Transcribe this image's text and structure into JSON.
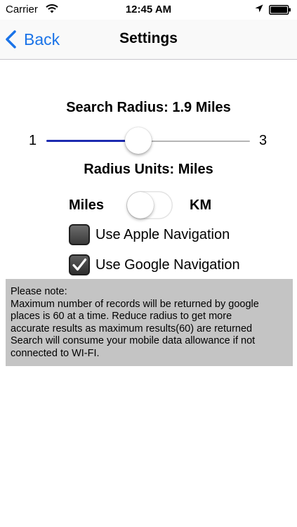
{
  "status_bar": {
    "carrier": "Carrier",
    "time": "12:45 AM",
    "icons": [
      "wifi-icon",
      "location-icon",
      "battery-icon"
    ]
  },
  "nav_bar": {
    "back_label": "Back",
    "title": "Settings",
    "accent_color": "#1a73e8"
  },
  "search_radius": {
    "label": "Search Radius: 1.9 Miles",
    "min_label": "1",
    "max_label": "3",
    "min": 1,
    "max": 3,
    "value": 1.9,
    "fill_color": "#1d2bb0"
  },
  "radius_units": {
    "label": "Radius Units: Miles",
    "left_label": "Miles",
    "right_label": "KM",
    "toggle_on": false
  },
  "navigation_options": {
    "apple_label": "Use Apple Navigation",
    "apple_checked": false,
    "google_label": "Use Google Navigation",
    "google_checked": true
  },
  "note": {
    "lines": [
      "Please note:",
      "Maximum number of records will be returned by google",
      "places is 60 at a time. Reduce radius to get more",
      "accurate results as maximum results(60) are returned",
      "Search will consume your mobile data allowance if not",
      "connected to WI-FI."
    ],
    "background_color": "#c4c4c4"
  }
}
